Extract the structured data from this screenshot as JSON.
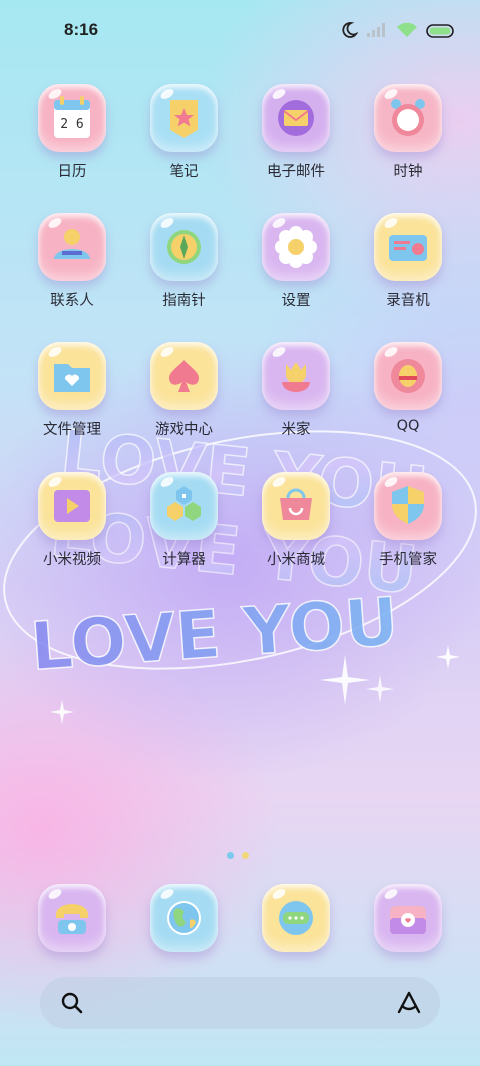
{
  "status_bar": {
    "time": "8:16",
    "icons": [
      "moon-icon",
      "signal-icon",
      "wifi-icon",
      "battery-icon"
    ]
  },
  "apps": [
    {
      "label": "日历",
      "icon": "calendar-icon",
      "tile": "#f7b3c4",
      "calendar_text": "2 6"
    },
    {
      "label": "笔记",
      "icon": "notes-icon",
      "tile": "#a9dff5"
    },
    {
      "label": "电子邮件",
      "icon": "mail-icon",
      "tile": "#d5b0ef"
    },
    {
      "label": "时钟",
      "icon": "clock-icon",
      "tile": "#f7b6c6"
    },
    {
      "label": "联系人",
      "icon": "contacts-icon",
      "tile": "#f7b3c4"
    },
    {
      "label": "指南针",
      "icon": "compass-icon",
      "tile": "#a6dcf3"
    },
    {
      "label": "设置",
      "icon": "settings-icon",
      "tile": "#d9b6f0"
    },
    {
      "label": "录音机",
      "icon": "recorder-icon",
      "tile": "#fbe39a"
    },
    {
      "label": "文件管理",
      "icon": "folder-icon",
      "tile": "#fbe39a"
    },
    {
      "label": "游戏中心",
      "icon": "game-center-icon",
      "tile": "#fbe39a"
    },
    {
      "label": "米家",
      "icon": "mijia-icon",
      "tile": "#d9b6f0"
    },
    {
      "label": "QQ",
      "icon": "qq-icon",
      "tile": "#f7b3c4"
    },
    {
      "label": "小米视频",
      "icon": "video-icon",
      "tile": "#fbe39a"
    },
    {
      "label": "计算器",
      "icon": "calculator-icon",
      "tile": "#a6dcf3"
    },
    {
      "label": "小米商城",
      "icon": "mi-store-icon",
      "tile": "#fbe39a"
    },
    {
      "label": "手机管家",
      "icon": "security-icon",
      "tile": "#f7b3c4"
    }
  ],
  "wallpaper_text": [
    "LOVE YOU",
    "LOVE YOU",
    "LOVE YOU"
  ],
  "page_indicator": {
    "count": 2,
    "active": 1,
    "colors": [
      "#7cc9ee",
      "#f2d77a"
    ]
  },
  "dock": [
    {
      "icon": "phone-icon",
      "tile": "#d9b6f0"
    },
    {
      "icon": "browser-icon",
      "tile": "#a6dcf3"
    },
    {
      "icon": "messages-icon",
      "tile": "#fbe39a"
    },
    {
      "icon": "camera-icon",
      "tile": "#d9b6f0"
    }
  ],
  "search": {
    "icon": "search-icon",
    "assistant_icon": "assistant-icon"
  }
}
